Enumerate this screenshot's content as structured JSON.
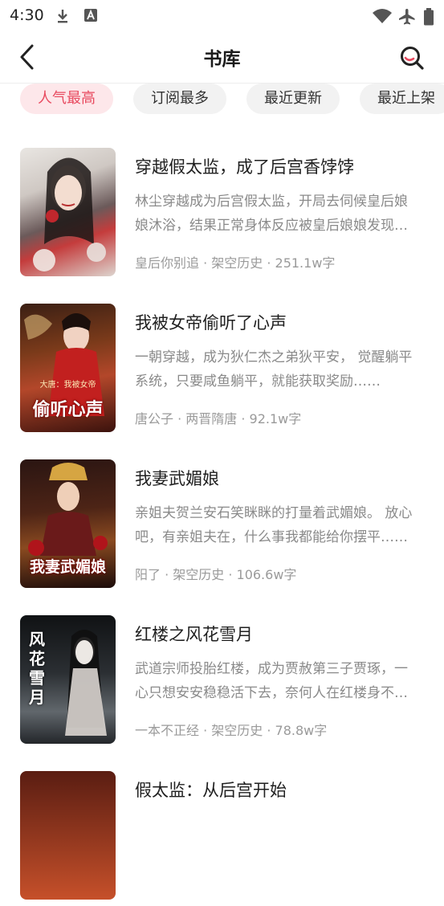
{
  "status_bar": {
    "time": "4:30",
    "icons": [
      "download-icon",
      "accessibility-a-icon",
      "wifi-icon",
      "airplane-icon",
      "battery-icon"
    ]
  },
  "header": {
    "title": "书库",
    "back_icon": "chevron-left-icon",
    "search_icon": "search-icon"
  },
  "colors": {
    "accent": "#e84a5f",
    "active_tab_bg": "#fde7ea",
    "tab_bg": "#f2f2f2",
    "desc_text": "#8a8a8a"
  },
  "tabs": [
    {
      "label": "人气最高",
      "active": true
    },
    {
      "label": "订阅最多",
      "active": false
    },
    {
      "label": "最近更新",
      "active": false
    },
    {
      "label": "最近上架",
      "active": false
    }
  ],
  "books": [
    {
      "title": "穿越假太监，成了后宫香饽饽",
      "description": "林尘穿越成为后宫假太监，开局去伺候皇后娘娘沐浴，结果正常身体反应被皇后娘娘发现了……",
      "meta": "皇后你别追 · 架空历史 · 251.1w字",
      "cover_text": ""
    },
    {
      "title": "我被女帝偷听了心声",
      "description": "一朝穿越，成为狄仁杰之弟狄平安， 觉醒躺平系统，只要咸鱼躺平，就能获取奖励……",
      "meta": "唐公子 · 两晋隋唐 · 92.1w字",
      "cover_text": "偷听心声",
      "cover_sub": "大唐：我被女帝"
    },
    {
      "title": "我妻武媚娘",
      "description": "亲姐夫贺兰安石笑眯眯的打量着武媚娘。 放心吧，有亲姐夫在，什么事我都能给你摆平……",
      "meta": "阳了 · 架空历史 · 106.6w字",
      "cover_text": "我妻武媚娘"
    },
    {
      "title": "红楼之风花雪月",
      "description": "武道宗师投胎红楼，成为贾赦第三子贾琢，一心只想安安稳稳活下去，奈何人在红楼身不由己……",
      "meta": "一本不正经 · 架空历史 · 78.8w字",
      "cover_text": "风花雪月"
    },
    {
      "title": "假太监：从后宫开始",
      "description": "",
      "meta": "",
      "cover_text": ""
    }
  ]
}
